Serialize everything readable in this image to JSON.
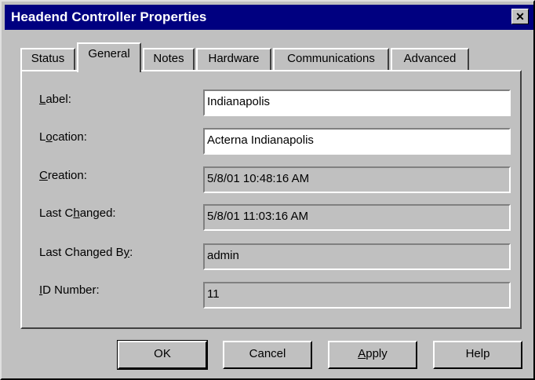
{
  "window": {
    "title": "Headend Controller Properties",
    "close_glyph": "✕"
  },
  "tabs": [
    {
      "label": "Status"
    },
    {
      "label": "General"
    },
    {
      "label": "Notes"
    },
    {
      "label": "Hardware"
    },
    {
      "label": "Communications"
    },
    {
      "label": "Advanced"
    }
  ],
  "active_tab": "General",
  "fields": {
    "label": {
      "caption_pre": "",
      "caption_key": "L",
      "caption_post": "abel:",
      "value": "Indianapolis"
    },
    "location": {
      "caption_pre": "L",
      "caption_key": "o",
      "caption_post": "cation:",
      "value": "Acterna Indianapolis"
    },
    "creation": {
      "caption_pre": "",
      "caption_key": "C",
      "caption_post": "reation:",
      "value": "5/8/01 10:48:16 AM"
    },
    "last_changed": {
      "caption_pre": "Last C",
      "caption_key": "h",
      "caption_post": "anged:",
      "value": "5/8/01 11:03:16 AM"
    },
    "last_changed_by": {
      "caption_pre": "Last Changed B",
      "caption_key": "y",
      "caption_post": ":",
      "value": "admin"
    },
    "id_number": {
      "caption_pre": "",
      "caption_key": "I",
      "caption_post": "D Number:",
      "value": "11"
    }
  },
  "buttons": {
    "ok": "OK",
    "cancel": "Cancel",
    "apply_key": "A",
    "apply_rest": "pply",
    "help": "Help"
  }
}
